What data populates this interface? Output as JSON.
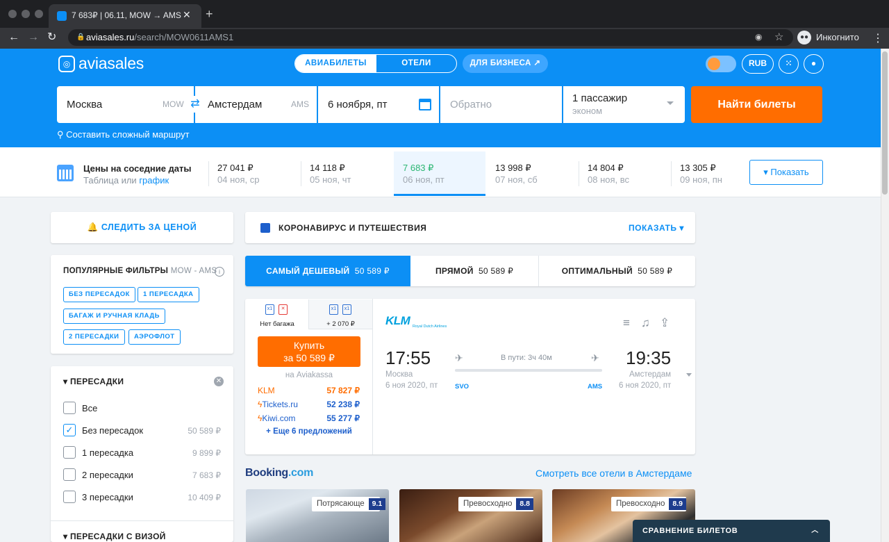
{
  "browser": {
    "tab_title": "7 683₽ | 06.11, MOW → AMS",
    "tab_close": "✕",
    "new_tab": "+",
    "url_domain": "aviasales.ru",
    "url_path": "/search/MOW0611AMS1",
    "profile_label": "Инкогнито"
  },
  "header": {
    "logo": "aviasales",
    "tabs": [
      "АВИАБИЛЕТЫ",
      "ОТЕЛИ"
    ],
    "business_label": "ДЛЯ БИЗНЕСА ↗",
    "currency": "RUB"
  },
  "search": {
    "origin": "Москва",
    "origin_code": "MOW",
    "destination": "Амстердам",
    "destination_code": "AMS",
    "depart_date": "6 ноября, пт",
    "return_placeholder": "Обратно",
    "passengers": "1 пассажир",
    "cabin_class": "эконом",
    "find_button": "Найти билеты",
    "complex_route": "Составить сложный маршрут"
  },
  "price_strip": {
    "title": "Цены на соседние даты",
    "subtitle_prefix": "Таблица или ",
    "subtitle_link": "график",
    "show_button": "▾ Показать",
    "days": [
      {
        "price": "27 041 ₽",
        "date": "04 ноя, ср",
        "selected": false
      },
      {
        "price": "14 118 ₽",
        "date": "05 ноя, чт",
        "selected": false
      },
      {
        "price": "7 683 ₽",
        "date": "06 ноя, пт",
        "selected": true
      },
      {
        "price": "13 998 ₽",
        "date": "07 ноя, сб",
        "selected": false
      },
      {
        "price": "14 804 ₽",
        "date": "08 ноя, вс",
        "selected": false
      },
      {
        "price": "13 305 ₽",
        "date": "09 ноя, пн",
        "selected": false
      }
    ]
  },
  "sidebar": {
    "follow_label": "СЛЕДИТЬ ЗА ЦЕНОЙ",
    "popular_title": "ПОПУЛЯРНЫЕ ФИЛЬТРЫ",
    "popular_route": "MOW - AMS",
    "chips": [
      "БЕЗ ПЕРЕСАДОК",
      "1 ПЕРЕСАДКА",
      "БАГАЖ И РУЧНАЯ КЛАДЬ",
      "2 ПЕРЕСАДКИ",
      "АЭРОФЛОТ"
    ],
    "stops_title": "ПЕРЕСАДКИ",
    "stops": [
      {
        "label": "Все",
        "price": "",
        "checked": false
      },
      {
        "label": "Без пересадок",
        "price": "50 589 ₽",
        "checked": true
      },
      {
        "label": "1 пересадка",
        "price": "9 899 ₽",
        "checked": false
      },
      {
        "label": "2 пересадки",
        "price": "7 683 ₽",
        "checked": false
      },
      {
        "label": "3 пересадки",
        "price": "10 409 ₽",
        "checked": false
      }
    ],
    "visa_title": "ПЕРЕСАДКИ С ВИЗОЙ"
  },
  "main": {
    "covid_title": "КОРОНАВИРУС И ПУТЕШЕСТВИЯ",
    "covid_show": "ПОКАЗАТЬ ▾",
    "sort_tabs": [
      {
        "label": "САМЫЙ ДЕШЕВЫЙ",
        "value": "50 589 ₽"
      },
      {
        "label": "ПРЯМОЙ",
        "value": "50 589 ₽"
      },
      {
        "label": "ОПТИМАЛЬНЫЙ",
        "value": "50 589 ₽"
      }
    ],
    "ticket": {
      "bag_option_1": "Нет багажа",
      "bag_option_2": "+ 2 070 ₽",
      "buy_line1": "Купить",
      "buy_line2": "за 50 589 ₽",
      "via": "на Aviakassa",
      "agencies": [
        {
          "name": "KLM",
          "price": "57 827 ₽",
          "color": "#ff6d00"
        },
        {
          "name": "Tickets.ru",
          "price": "52 238 ₽",
          "color": "#1d5fcc"
        },
        {
          "name": "Kiwi.com",
          "price": "55 277 ₽",
          "color": "#1d5fcc"
        }
      ],
      "more_offers": "+ Еще 6 предложений",
      "airline": "KLM",
      "airline_sub": "Royal Dutch Airlines",
      "depart_time": "17:55",
      "arrive_time": "19:35",
      "depart_city": "Москва",
      "arrive_city": "Амстердам",
      "depart_date": "6 ноя 2020, пт",
      "arrive_date": "6 ноя 2020, пт",
      "duration": "В пути: 3ч 40м",
      "depart_airport": "SVO",
      "arrive_airport": "AMS"
    },
    "booking_brand_1": "Booking",
    "booking_brand_2": ".com",
    "all_hotels": "Смотреть все отели в Амстердаме",
    "hotels": [
      {
        "label": "Потрясающе",
        "score": "9.1"
      },
      {
        "label": "Превосходно",
        "score": "8.8"
      },
      {
        "label": "Превосходно",
        "score": "8.9"
      }
    ]
  },
  "compare_bar": "СРАВНЕНИЕ БИЛЕТОВ",
  "colors": {
    "brand": "#0c8ff5",
    "accent": "#ff6d00",
    "cheap": "#2bb673"
  }
}
